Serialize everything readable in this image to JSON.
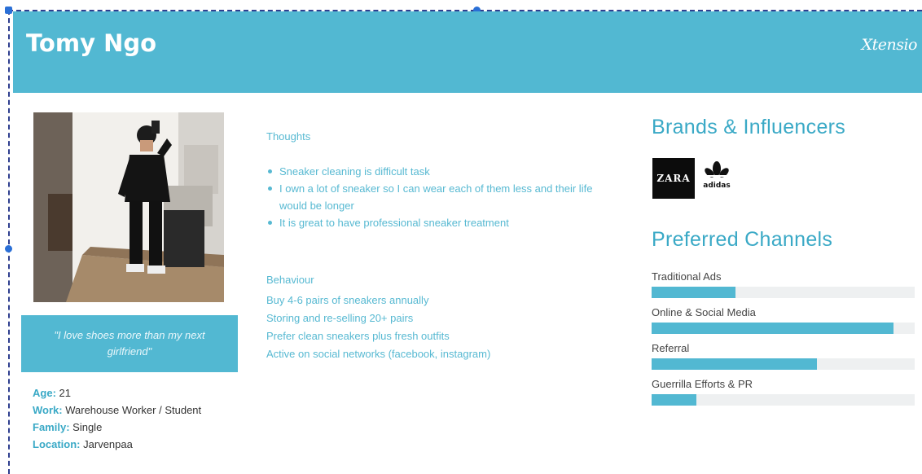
{
  "persona": {
    "name": "Tomy Ngo",
    "brand": "Xtensio",
    "quote": "\"I love shoes more than my next girlfriend\"",
    "details": [
      {
        "key": "Age",
        "value": "21"
      },
      {
        "key": "Work",
        "value": "Warehouse Worker / Student"
      },
      {
        "key": "Family",
        "value": "Single"
      },
      {
        "key": "Location",
        "value": "Jarvenpaa"
      }
    ]
  },
  "thoughts": {
    "title": "Thoughts",
    "items": [
      "Sneaker cleaning is difficult task",
      "I own a lot of sneaker so I can wear each of them less and their life would be longer",
      "It is great to have professional sneaker treatment"
    ]
  },
  "behaviour": {
    "title": "Behaviour",
    "items": [
      "Buy 4-6 pairs of sneakers annually",
      "Storing and re-selling 20+ pairs",
      "Prefer clean sneakers plus fresh outfits",
      "Active on social networks (facebook, instagram)"
    ]
  },
  "brands": {
    "title": "Brands & Influencers",
    "logos": [
      {
        "name": "ZARA",
        "icon": "zara-logo"
      },
      {
        "name": "adidas",
        "icon": "adidas-logo"
      }
    ]
  },
  "channels": {
    "title": "Preferred Channels",
    "items": [
      {
        "label": "Traditional Ads",
        "level": 0.32
      },
      {
        "label": "Online & Social Media",
        "level": 0.92
      },
      {
        "label": "Referral",
        "level": 0.63
      },
      {
        "label": "Guerrilla Efforts & PR",
        "level": 0.17
      }
    ]
  },
  "colors": {
    "accent": "#52b8d2",
    "text_accent": "#3aa9c6",
    "track": "#eef0f1"
  }
}
